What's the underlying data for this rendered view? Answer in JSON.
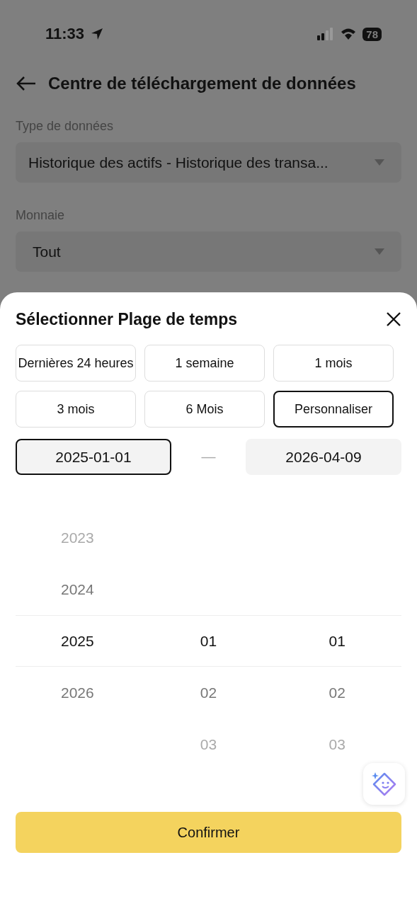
{
  "status_bar": {
    "time": "11:33",
    "battery": "78"
  },
  "header": {
    "title": "Centre de téléchargement de données"
  },
  "fields": [
    {
      "label": "Type de données",
      "value": "Historique des actifs - Historique des transa..."
    },
    {
      "label": "Monnaie",
      "value": "Tout"
    }
  ],
  "sheet": {
    "title": "Sélectionner Plage de temps",
    "presets": [
      {
        "label": "Dernières 24 heures",
        "selected": false
      },
      {
        "label": "1 semaine",
        "selected": false
      },
      {
        "label": "1 mois",
        "selected": false
      },
      {
        "label": "3 mois",
        "selected": false
      },
      {
        "label": "6 Mois",
        "selected": false
      },
      {
        "label": "Personnaliser",
        "selected": true
      }
    ],
    "start_date": {
      "value": "2025-01-01",
      "selected": true
    },
    "separator": "—",
    "end_date": {
      "value": "2026-04-09",
      "selected": false
    },
    "picker": [
      [
        {
          "label": "2023",
          "selected": false
        },
        {
          "label": "2024",
          "selected": false
        },
        {
          "label": "2025",
          "selected": true
        },
        {
          "label": "2026",
          "selected": false
        }
      ],
      [
        {
          "label": "01",
          "selected": true
        },
        {
          "label": "02",
          "selected": false
        },
        {
          "label": "03",
          "selected": false
        }
      ],
      [
        {
          "label": "01",
          "selected": true
        },
        {
          "label": "02",
          "selected": false
        },
        {
          "label": "03",
          "selected": false
        }
      ]
    ],
    "confirm": "Confirmer"
  }
}
